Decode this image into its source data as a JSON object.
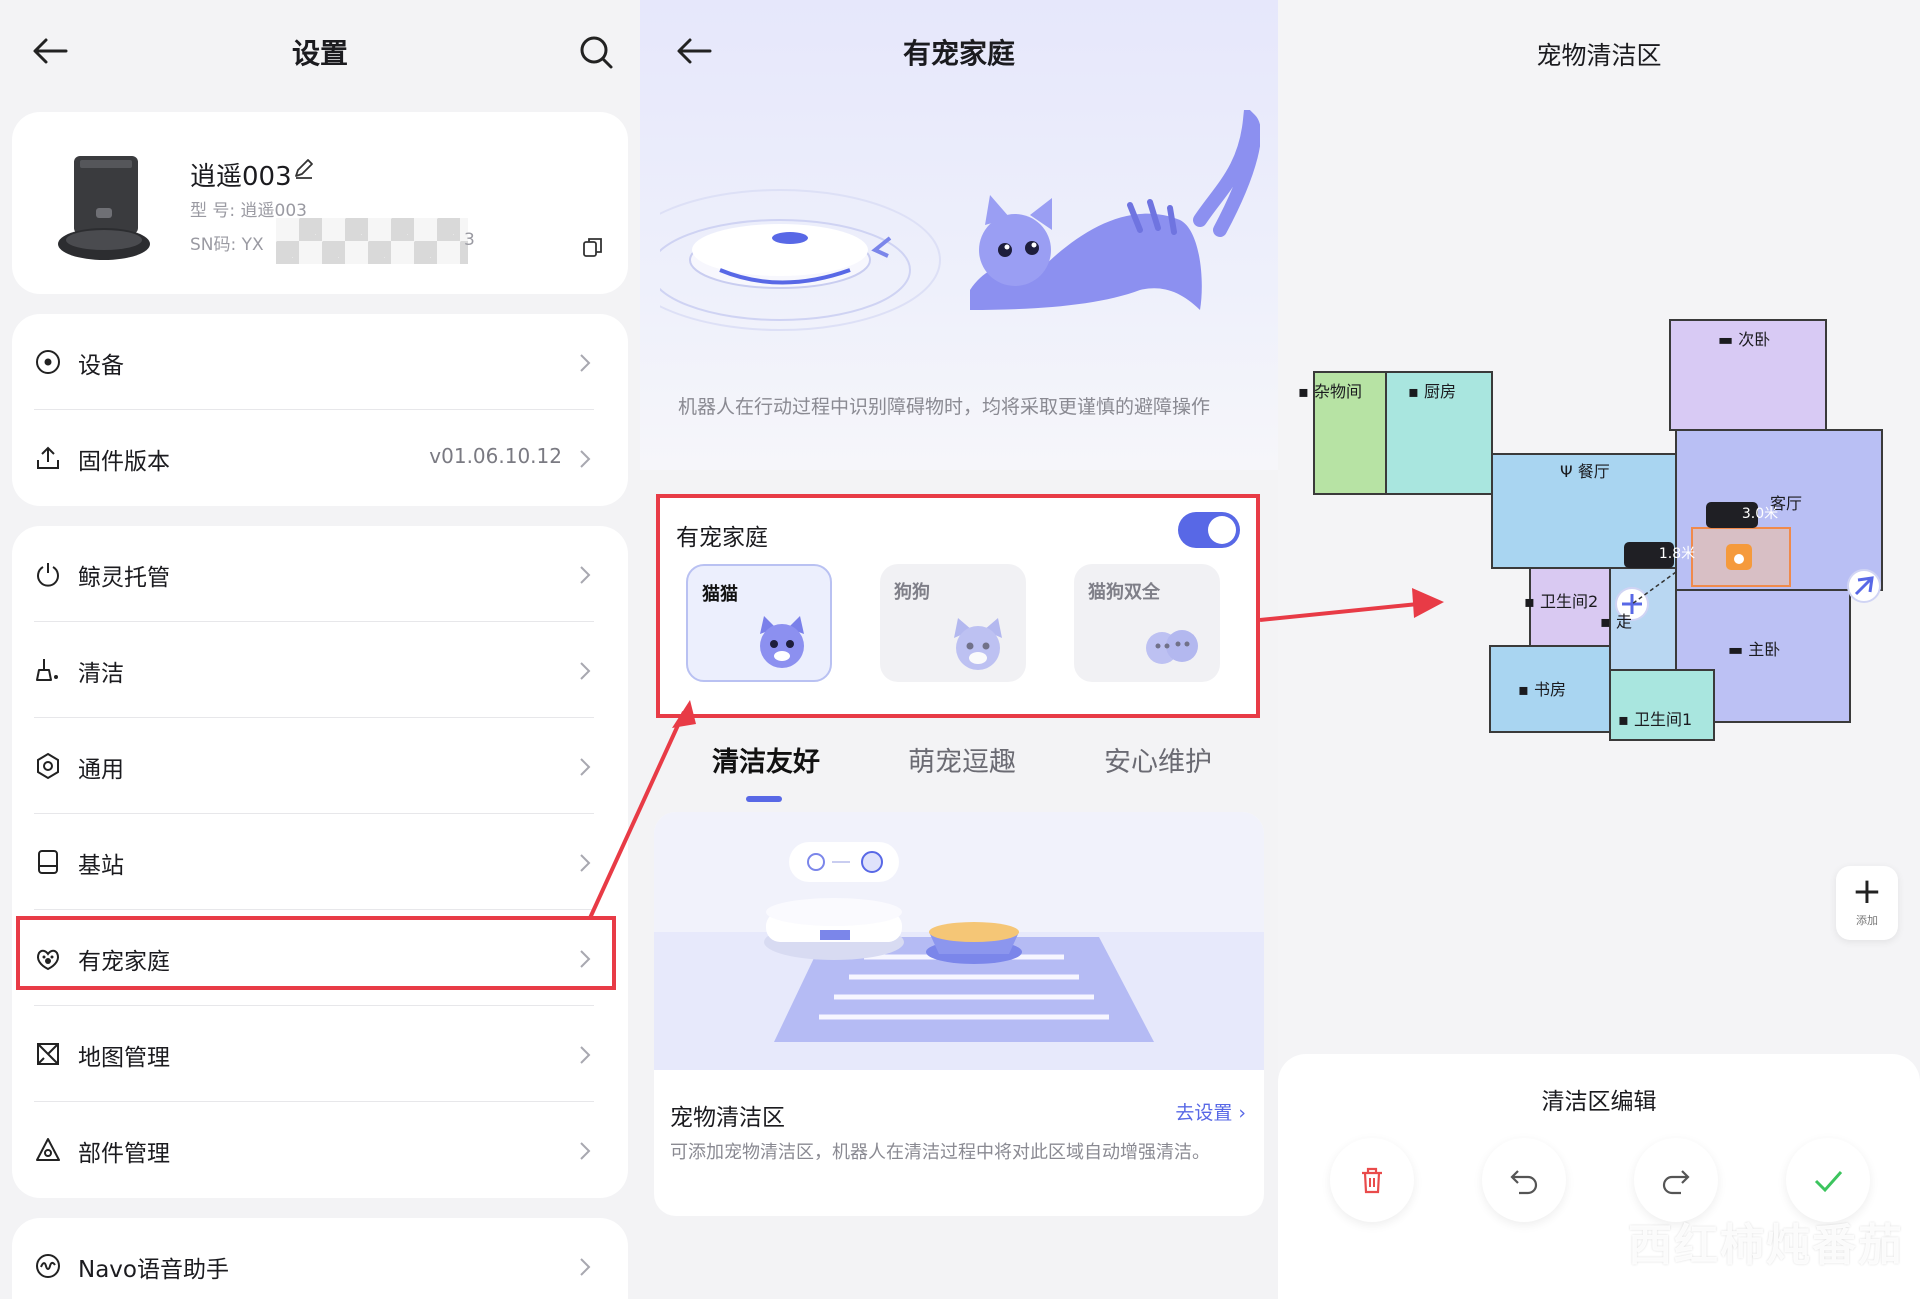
{
  "settings": {
    "title": "设置",
    "device": {
      "name": "逍遥003",
      "model": "型  号: 逍遥003",
      "sn_prefix": "SN码: YX",
      "sn_suffix": "3"
    },
    "rows_group1": [
      {
        "label": "设备",
        "icon": "target-icon"
      },
      {
        "label": "固件版本",
        "value": "v01.06.10.12",
        "icon": "upload-icon"
      }
    ],
    "rows_group2": [
      {
        "label": "鲸灵托管",
        "icon": "power-icon"
      },
      {
        "label": "清洁",
        "icon": "broom-icon"
      },
      {
        "label": "通用",
        "icon": "gear-icon"
      },
      {
        "label": "基站",
        "icon": "station-icon"
      },
      {
        "label": "有宠家庭",
        "icon": "paw-icon"
      },
      {
        "label": "地图管理",
        "icon": "map-icon"
      },
      {
        "label": "部件管理",
        "icon": "parts-icon"
      }
    ],
    "rows_group3": [
      {
        "label": "Navo语音助手",
        "icon": "voice-icon"
      }
    ]
  },
  "pet": {
    "title": "有宠家庭",
    "description": "机器人在行动过程中识别障碍物时，均将采取更谨慎的避障操作",
    "card_title": "有宠家庭",
    "toggle_on": true,
    "options": [
      {
        "label": "猫猫",
        "selected": true
      },
      {
        "label": "狗狗",
        "selected": false
      },
      {
        "label": "猫狗双全",
        "selected": false
      }
    ],
    "tabs": [
      "清洁友好",
      "萌宠逗趣",
      "安心维护"
    ],
    "active_tab": 0,
    "feature": {
      "title": "宠物清洁区",
      "link": "去设置",
      "description": "可添加宠物清洁区，机器人在清洁过程中将对此区域自动增强清洁。"
    }
  },
  "map": {
    "title": "宠物清洁区",
    "rooms": [
      {
        "label": "杂物间"
      },
      {
        "label": "厨房"
      },
      {
        "label": "次卧"
      },
      {
        "label": "餐厅"
      },
      {
        "label": "客厅"
      },
      {
        "label": "卫生间2"
      },
      {
        "label": "走"
      },
      {
        "label": "主卧"
      },
      {
        "label": "书房"
      },
      {
        "label": "卫生间1"
      }
    ],
    "dim_width": "3.0米",
    "dim_height": "1.8米",
    "add_label": "添加",
    "sheet_title": "清洁区编辑",
    "watermark": "西红柿炖番茄",
    "colors": {
      "accent": "#5868e6",
      "confirm": "#3cc45e",
      "delete": "#e94b4b",
      "highlight": "#e83b46"
    }
  }
}
